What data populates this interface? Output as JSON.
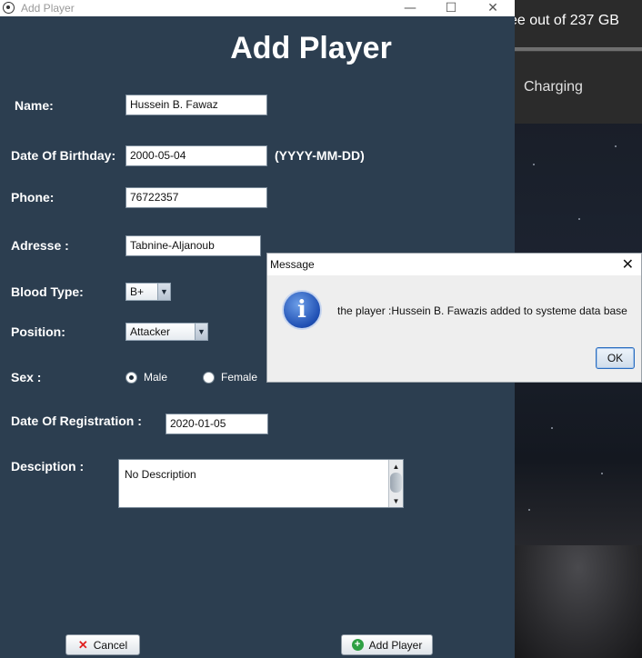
{
  "desktop": {
    "storage_text": "ee out of 237 GB",
    "battery_text": "Charging"
  },
  "window": {
    "title": "Add Player",
    "controls": {
      "minimize": "—",
      "maximize": "☐",
      "close": "✕"
    }
  },
  "form": {
    "heading": "Add Player",
    "name_label": "Name:",
    "name_value": "Hussein B. Fawaz",
    "dob_label": "Date Of Birthday:",
    "dob_value": "2000-05-04",
    "dob_hint": "(YYYY-MM-DD)",
    "phone_label": "Phone:",
    "phone_value": "76722357",
    "address_label": "Adresse :",
    "address_value": "Tabnine-Aljanoub",
    "blood_label": "Blood Type:",
    "blood_value": "B+",
    "position_label": "Position:",
    "position_value": "Attacker",
    "sex_label": "Sex :",
    "sex_options": [
      {
        "label": "Male",
        "selected": true
      },
      {
        "label": "Female",
        "selected": false
      }
    ],
    "registration_label": "Date Of Registration :",
    "registration_value": "2020-01-05",
    "description_label": "Desciption :",
    "description_value": "No Description",
    "cancel_label": "Cancel",
    "add_label": "Add Player"
  },
  "dialog": {
    "title": "Message",
    "message": "the player :Hussein B. Fawazis added to systeme data base",
    "ok_label": "OK",
    "icon": "info-icon"
  },
  "colors": {
    "window_bg": "#2c3e50",
    "cancel_icon": "#e02020",
    "add_icon": "#2ea043"
  }
}
